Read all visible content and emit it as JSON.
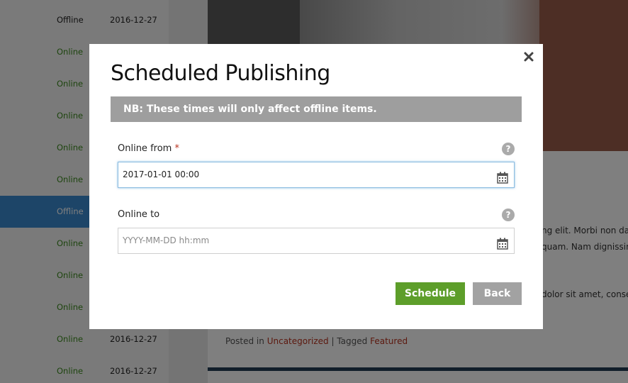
{
  "background": {
    "list_rows": [
      {
        "status": "Offline",
        "date": "2016-12-27",
        "offline": true,
        "selected": false
      },
      {
        "status": "Online",
        "date": "",
        "offline": false,
        "selected": false
      },
      {
        "status": "Online",
        "date": "",
        "offline": false,
        "selected": false
      },
      {
        "status": "Online",
        "date": "",
        "offline": false,
        "selected": false
      },
      {
        "status": "Online",
        "date": "",
        "offline": false,
        "selected": false
      },
      {
        "status": "Online",
        "date": "",
        "offline": false,
        "selected": false
      },
      {
        "status": "Offline",
        "date": "",
        "offline": true,
        "selected": true
      },
      {
        "status": "Online",
        "date": "",
        "offline": false,
        "selected": false
      },
      {
        "status": "Online",
        "date": "",
        "offline": false,
        "selected": false
      },
      {
        "status": "Online",
        "date": "",
        "offline": false,
        "selected": false
      },
      {
        "status": "Online",
        "date": "2016-12-27",
        "offline": false,
        "selected": false
      },
      {
        "status": "Online",
        "date": "2016-12-27",
        "offline": false,
        "selected": false
      }
    ],
    "article_text_1": "ng elit. Morbi non dap",
    "article_text_2": "quam. Nam dignissim",
    "article_text_3": "dolor sit amet, consec",
    "posted_in_label": "Posted in",
    "category_link": "Uncategorized",
    "tagged_label": "| Tagged",
    "tag_link": "Featured"
  },
  "modal": {
    "title": "Scheduled Publishing",
    "notice": "NB: These times will only affect offline items.",
    "online_from": {
      "label": "Online from",
      "required_mark": "*",
      "value": "2017-01-01 00:00",
      "help": "?"
    },
    "online_to": {
      "label": "Online to",
      "value": "",
      "placeholder": "YYYY-MM-DD hh:mm",
      "help": "?"
    },
    "schedule_label": "Schedule",
    "back_label": "Back"
  },
  "colors": {
    "schedule_button": "#5d9e2a",
    "back_button": "#a2a2a2",
    "selected_row": "#3a8bd0",
    "online_status": "#3c8a1e"
  }
}
